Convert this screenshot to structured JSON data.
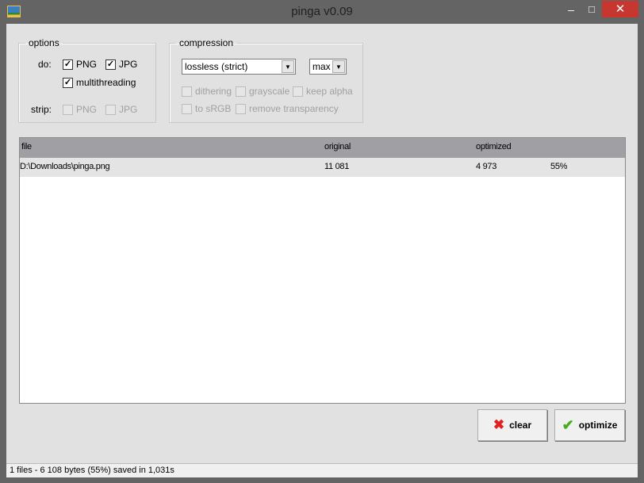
{
  "window": {
    "title": "pinga v0.09",
    "minimize": "–",
    "maximize": "□",
    "close": "✕"
  },
  "options": {
    "legend": "options",
    "do_label": "do:",
    "strip_label": "strip:",
    "do_png": {
      "label": "PNG",
      "checked": true
    },
    "do_jpg": {
      "label": "JPG",
      "checked": true
    },
    "multithreading": {
      "label": "multithreading",
      "checked": true
    },
    "strip_png": {
      "label": "PNG",
      "checked": false,
      "disabled": true
    },
    "strip_jpg": {
      "label": "JPG",
      "checked": false,
      "disabled": true
    }
  },
  "compression": {
    "legend": "compression",
    "mode": "lossless (strict)",
    "level": "max",
    "dithering": "dithering",
    "grayscale": "grayscale",
    "keep_alpha": "keep alpha",
    "to_srgb": "to sRGB",
    "remove_transparency": "remove transparency"
  },
  "list": {
    "headers": [
      "file",
      "original",
      "optimized"
    ],
    "rows": [
      {
        "file": "D:\\Downloads\\pinga.png",
        "original": "11 081",
        "optimized": "4 973",
        "ratio": "55%"
      }
    ]
  },
  "buttons": {
    "clear": "clear",
    "optimize": "optimize"
  },
  "status": "1 files - 6 108 bytes (55%) saved in 1,031s",
  "colors": {
    "close": "#c7372f",
    "header": "#a0a0a4"
  }
}
